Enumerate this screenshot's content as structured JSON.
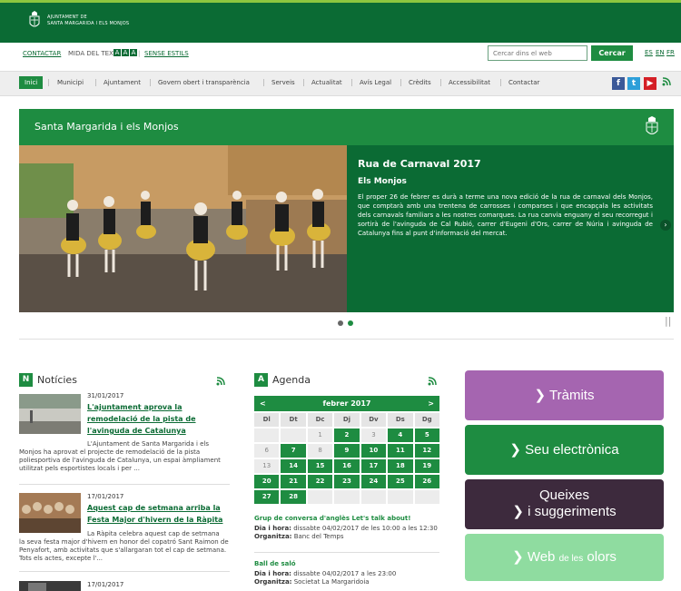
{
  "header": {
    "logo_line1": "AJUNTAMENT DE",
    "logo_line2": "SANTA MARGARIDA I ELS MONJOS"
  },
  "utility": {
    "contact": "CONTACTAR",
    "text_size": "MIDA DEL TEXT:",
    "size_small": "A",
    "size_medium": "A",
    "size_large": "A",
    "no_styles": "SENSE ESTILS",
    "search_placeholder": "Cercar dins el web",
    "search_button": "Cercar",
    "lang_es": "ES",
    "lang_en": "EN",
    "lang_fr": "FR"
  },
  "nav": {
    "items": [
      "Inici",
      "Municipi",
      "Ajuntament",
      "Govern obert i transparència",
      "Serveis",
      "Actualitat",
      "Avís Legal",
      "Crèdits",
      "Accessibilitat",
      "Contactar"
    ]
  },
  "banner": {
    "title": "Santa Margarida i els Monjos"
  },
  "slide": {
    "title": "Rua de Carnaval 2017",
    "subtitle": "Els Monjos",
    "body": "El proper 26 de febrer es durà a terme una nova edició de la rua de carnaval dels Monjos, que comptarà amb una trentena de carrosses i comparses i que encapçala les activitats dels carnavals familiars a les nostres comarques. La rua canvia enguany el seu recorregut i sortirà de l'avinguda de Cal Rubió, carrer d'Eugeni d'Ors, carrer de Núria i avinguda de Catalunya fins al punt d'informació del mercat."
  },
  "news": {
    "letter": "N",
    "title": "Notícies",
    "items": [
      {
        "date": "31/01/2017",
        "title": "L'ajuntament aprova la remodelació de la pista de l'avinguda de Catalunya",
        "body_first": "L'Ajuntament de Santa Margarida i els",
        "body_rest": "Monjos ha aprovat el projecte de remodelació de la pista poliesportiva de l'avinguda de Catalunya, un espai àmpliament utilitzat pels esportistes locals i per ..."
      },
      {
        "date": "17/01/2017",
        "title": "Aquest cap de setmana arriba la Festa Major d'hivern de la Ràpita",
        "body_first": "La Ràpita celebra aquest cap de setmana",
        "body_rest": "la seva festa major d'hivern en honor del copatró Sant Raimon de Penyafort, amb activitats que s'allargaran tot el cap de setmana. Tots els actes, excepte l'..."
      },
      {
        "date": "17/01/2017"
      }
    ]
  },
  "agenda": {
    "letter": "A",
    "title": "Agenda",
    "month": "febrer 2017",
    "prev": "<",
    "next": ">",
    "dow": [
      "Dl",
      "Dt",
      "Dc",
      "Dj",
      "Dv",
      "Ds",
      "Dg"
    ],
    "weeks": [
      [
        "",
        "",
        "1",
        "2",
        "3",
        "4",
        "5"
      ],
      [
        "6",
        "7",
        "8",
        "9",
        "10",
        "11",
        "12"
      ],
      [
        "13",
        "14",
        "15",
        "16",
        "17",
        "18",
        "19"
      ],
      [
        "20",
        "21",
        "22",
        "23",
        "24",
        "25",
        "26"
      ],
      [
        "27",
        "28",
        "",
        "",
        "",
        "",
        ""
      ]
    ],
    "event_days": [
      "2",
      "4",
      "5",
      "7",
      "9",
      "10",
      "11",
      "12",
      "14",
      "15",
      "16",
      "17",
      "18",
      "19",
      "20",
      "21",
      "22",
      "23",
      "24",
      "25",
      "26",
      "27",
      "28"
    ],
    "events": [
      {
        "title": "Grup de conversa d'anglès Let's talk about!",
        "when_label": "Dia i hora:",
        "when": "dissabte 04/02/2017 de les 10:00 a les 12:30",
        "org_label": "Organitza:",
        "org": "Banc del Temps"
      },
      {
        "title": "Ball de saló",
        "when_label": "Dia i hora:",
        "when": "dissabte 04/02/2017 a les 23:00",
        "org_label": "Organitza:",
        "org": "Societat La Margaridoia"
      }
    ]
  },
  "quick_links": {
    "tramits": "Tràmits",
    "seu": "Seu electrònica",
    "queixes_1": "Queixes",
    "queixes_2": "i suggeriments",
    "web_1": "Web",
    "web_2": "de les",
    "web_3": "olors"
  },
  "colors": {
    "brand_dark": "#0b6b34",
    "brand": "#1e8c41",
    "tramits": "#a565b0",
    "queixes": "#3d2a3d",
    "web_olors": "#8fdca0"
  }
}
